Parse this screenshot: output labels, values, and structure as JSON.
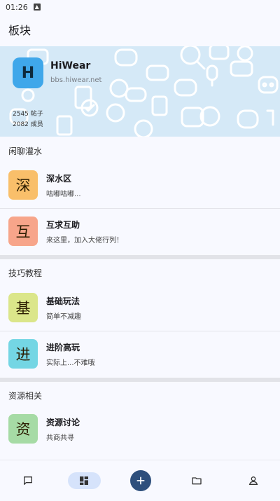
{
  "status_bar": {
    "time": "01:26"
  },
  "app_bar": {
    "title": "板块"
  },
  "forum": {
    "logo_letter": "H",
    "title": "HiWear",
    "url": "bbs.hiwear.net",
    "posts_stat": "2545 帖子",
    "members_stat": "2082 成员"
  },
  "sections": [
    {
      "title": "闲聊灌水",
      "boards": [
        {
          "glyph": "深",
          "name": "深水区",
          "desc": "咕嘟咕嘟...",
          "color": "#f7b45a"
        },
        {
          "glyph": "互",
          "name": "互求互助",
          "desc": "来这里，加入大佬行列！",
          "color": "#f49c80"
        }
      ]
    },
    {
      "title": "技巧教程",
      "boards": [
        {
          "glyph": "基",
          "name": "基础玩法",
          "desc": "简单不减趣",
          "color": "#d6e37a"
        },
        {
          "glyph": "进",
          "name": "进阶高玩",
          "desc": "实际上...不难哦",
          "color": "#63d0e0"
        }
      ]
    },
    {
      "title": "资源相关",
      "boards": [
        {
          "glyph": "资",
          "name": "资源讨论",
          "desc": "共商共寻",
          "color": "#9dd69b"
        }
      ]
    }
  ],
  "bottom_nav": {
    "items": [
      "chat-icon",
      "boards-icon",
      "add-icon",
      "folder-icon",
      "person-icon"
    ],
    "active": "boards-icon"
  }
}
